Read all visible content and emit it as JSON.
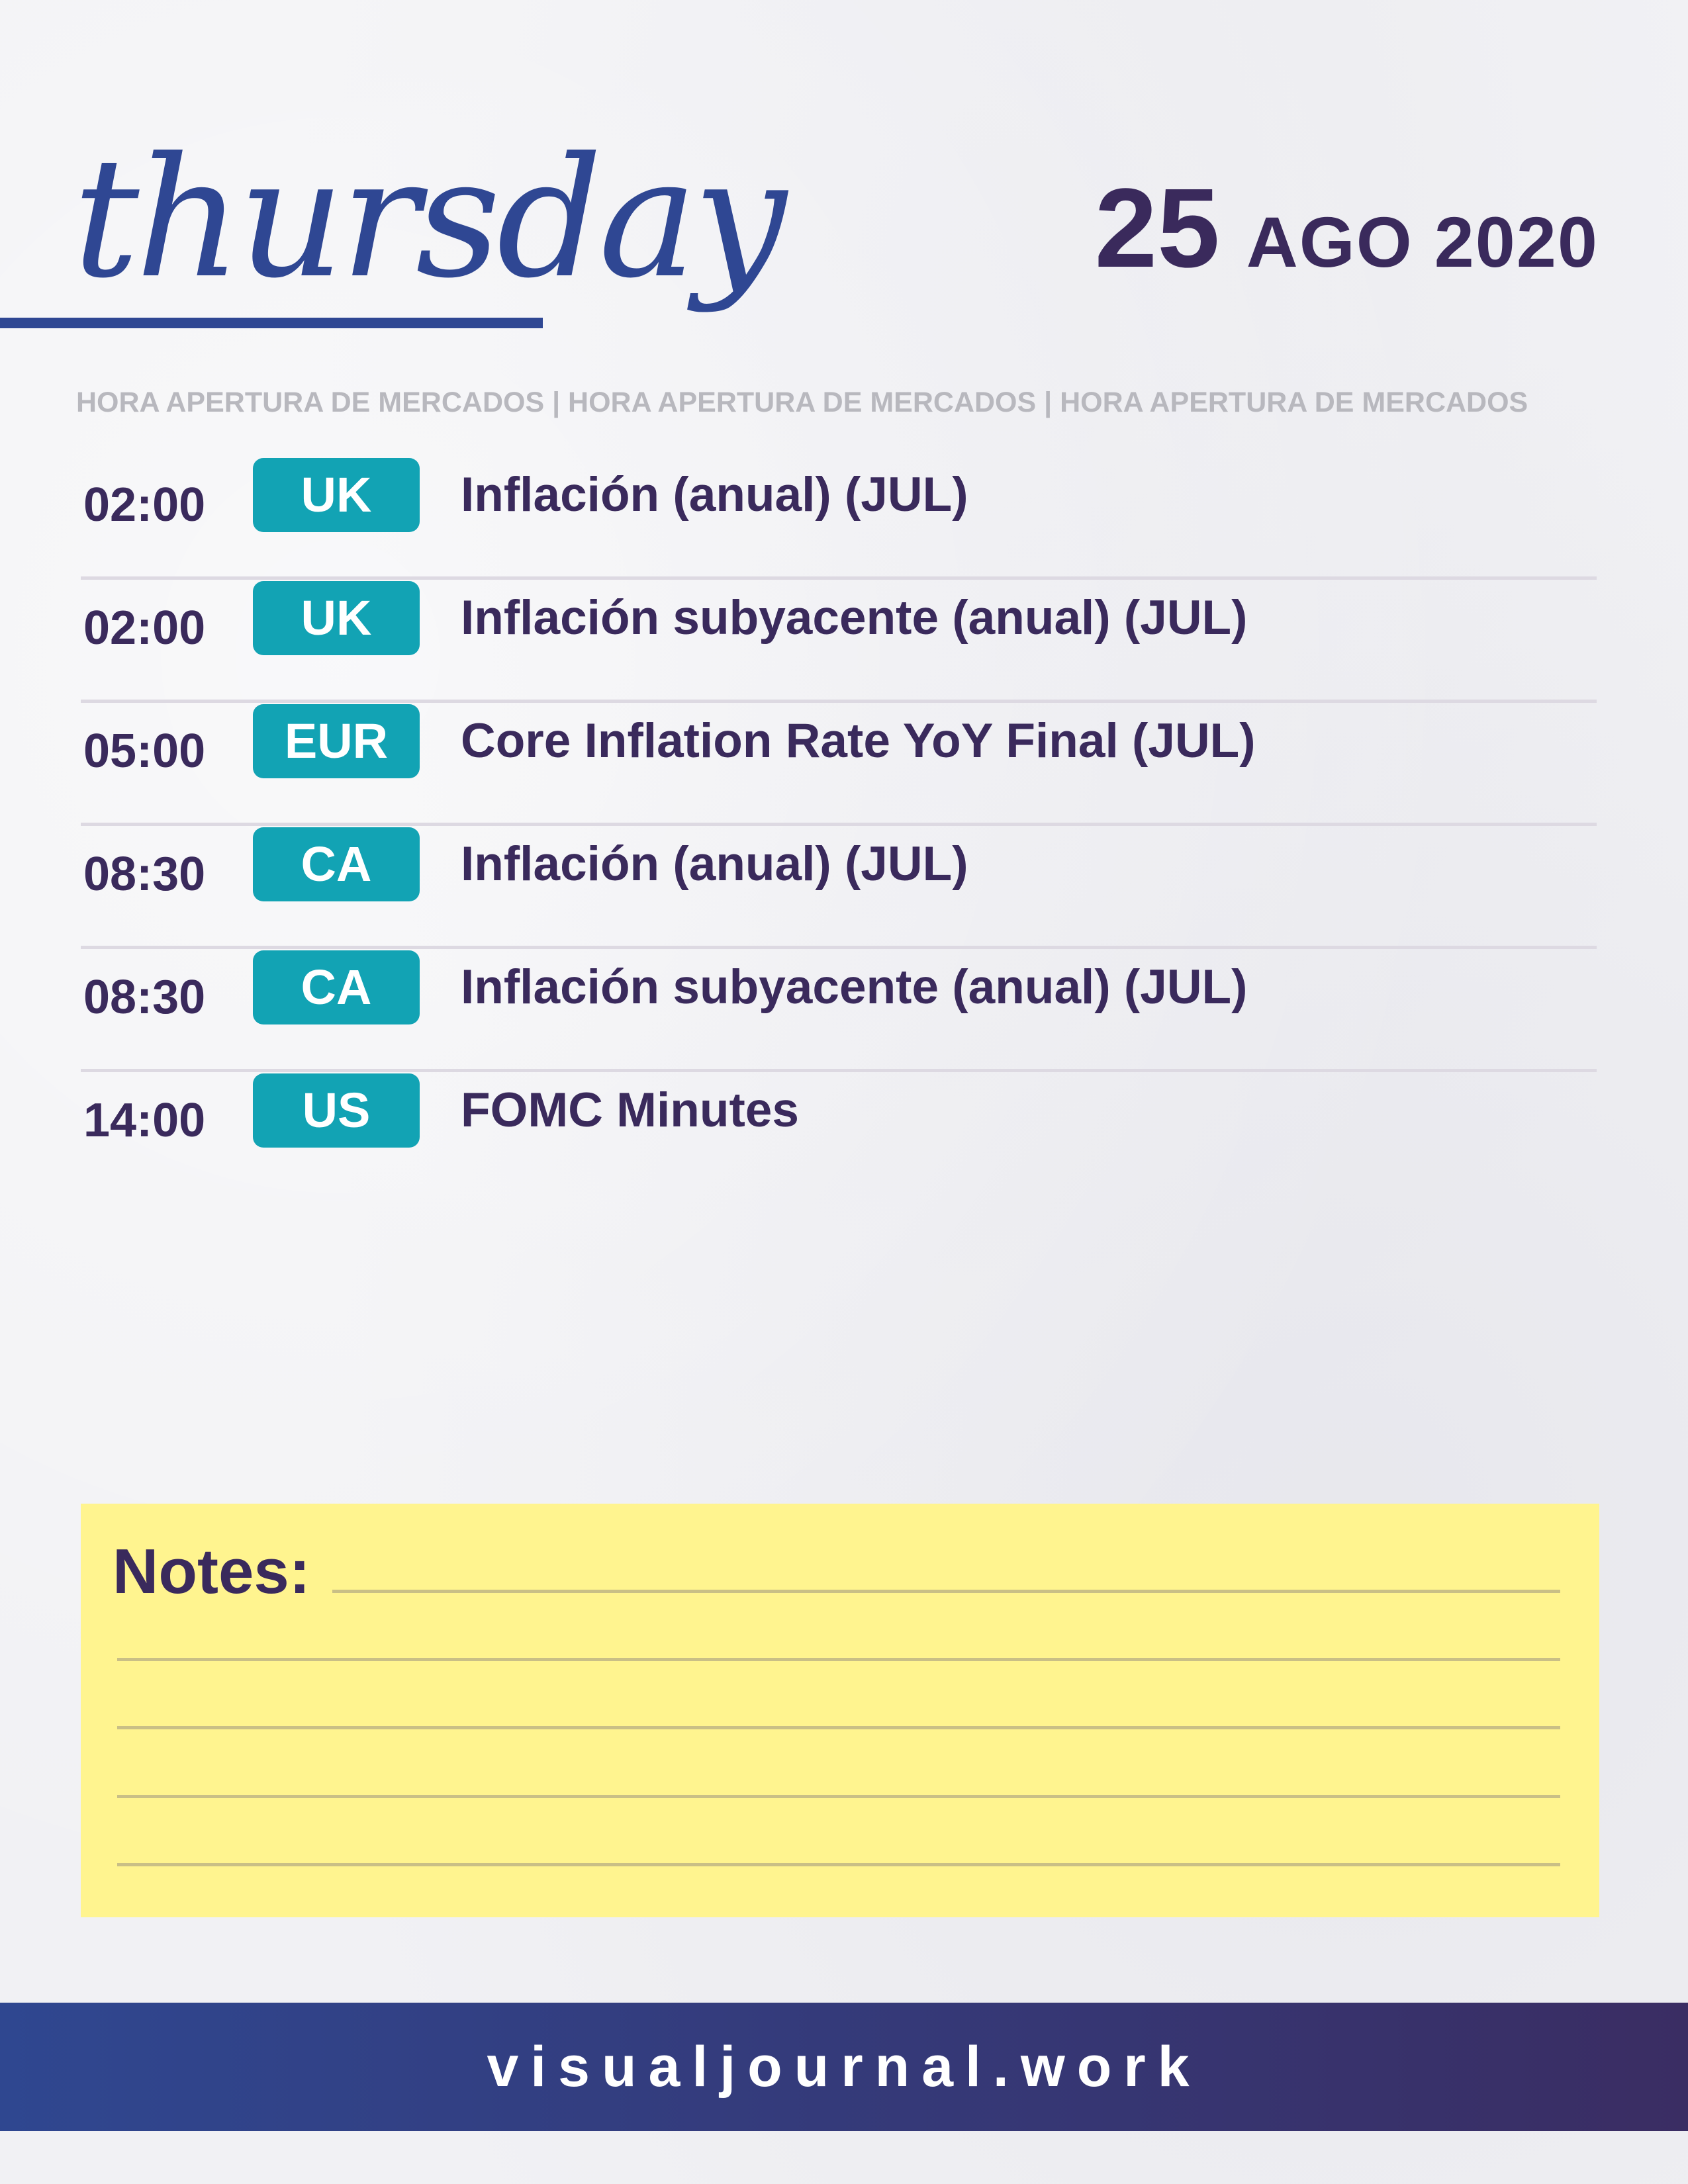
{
  "header": {
    "day_name": "thursday",
    "day_number": "25",
    "month_year": "AGO 2020",
    "subtitle": "HORA APERTURA DE MERCADOS | HORA APERTURA DE MERCADOS | HORA APERTURA DE MERCADOS"
  },
  "events": [
    {
      "time": "02:00",
      "region": "UK",
      "title": "Inflación (anual) (JUL)"
    },
    {
      "time": "02:00",
      "region": "UK",
      "title": "Inflación subyacente (anual) (JUL)"
    },
    {
      "time": "05:00",
      "region": "EUR",
      "title": "Core Inflation Rate YoY Final (JUL)"
    },
    {
      "time": "08:30",
      "region": "CA",
      "title": "Inflación (anual) (JUL)"
    },
    {
      "time": "08:30",
      "region": "CA",
      "title": "Inflación subyacente (anual) (JUL)"
    },
    {
      "time": "14:00",
      "region": "US",
      "title": "FOMC Minutes"
    }
  ],
  "notes": {
    "label": "Notes:"
  },
  "footer": {
    "website": "visualjournal.work"
  },
  "colors": {
    "title_blue": "#2f4793",
    "text_purple": "#3a2a5c",
    "badge_teal": "#12a3b4",
    "notes_yellow": "#fff48f"
  }
}
